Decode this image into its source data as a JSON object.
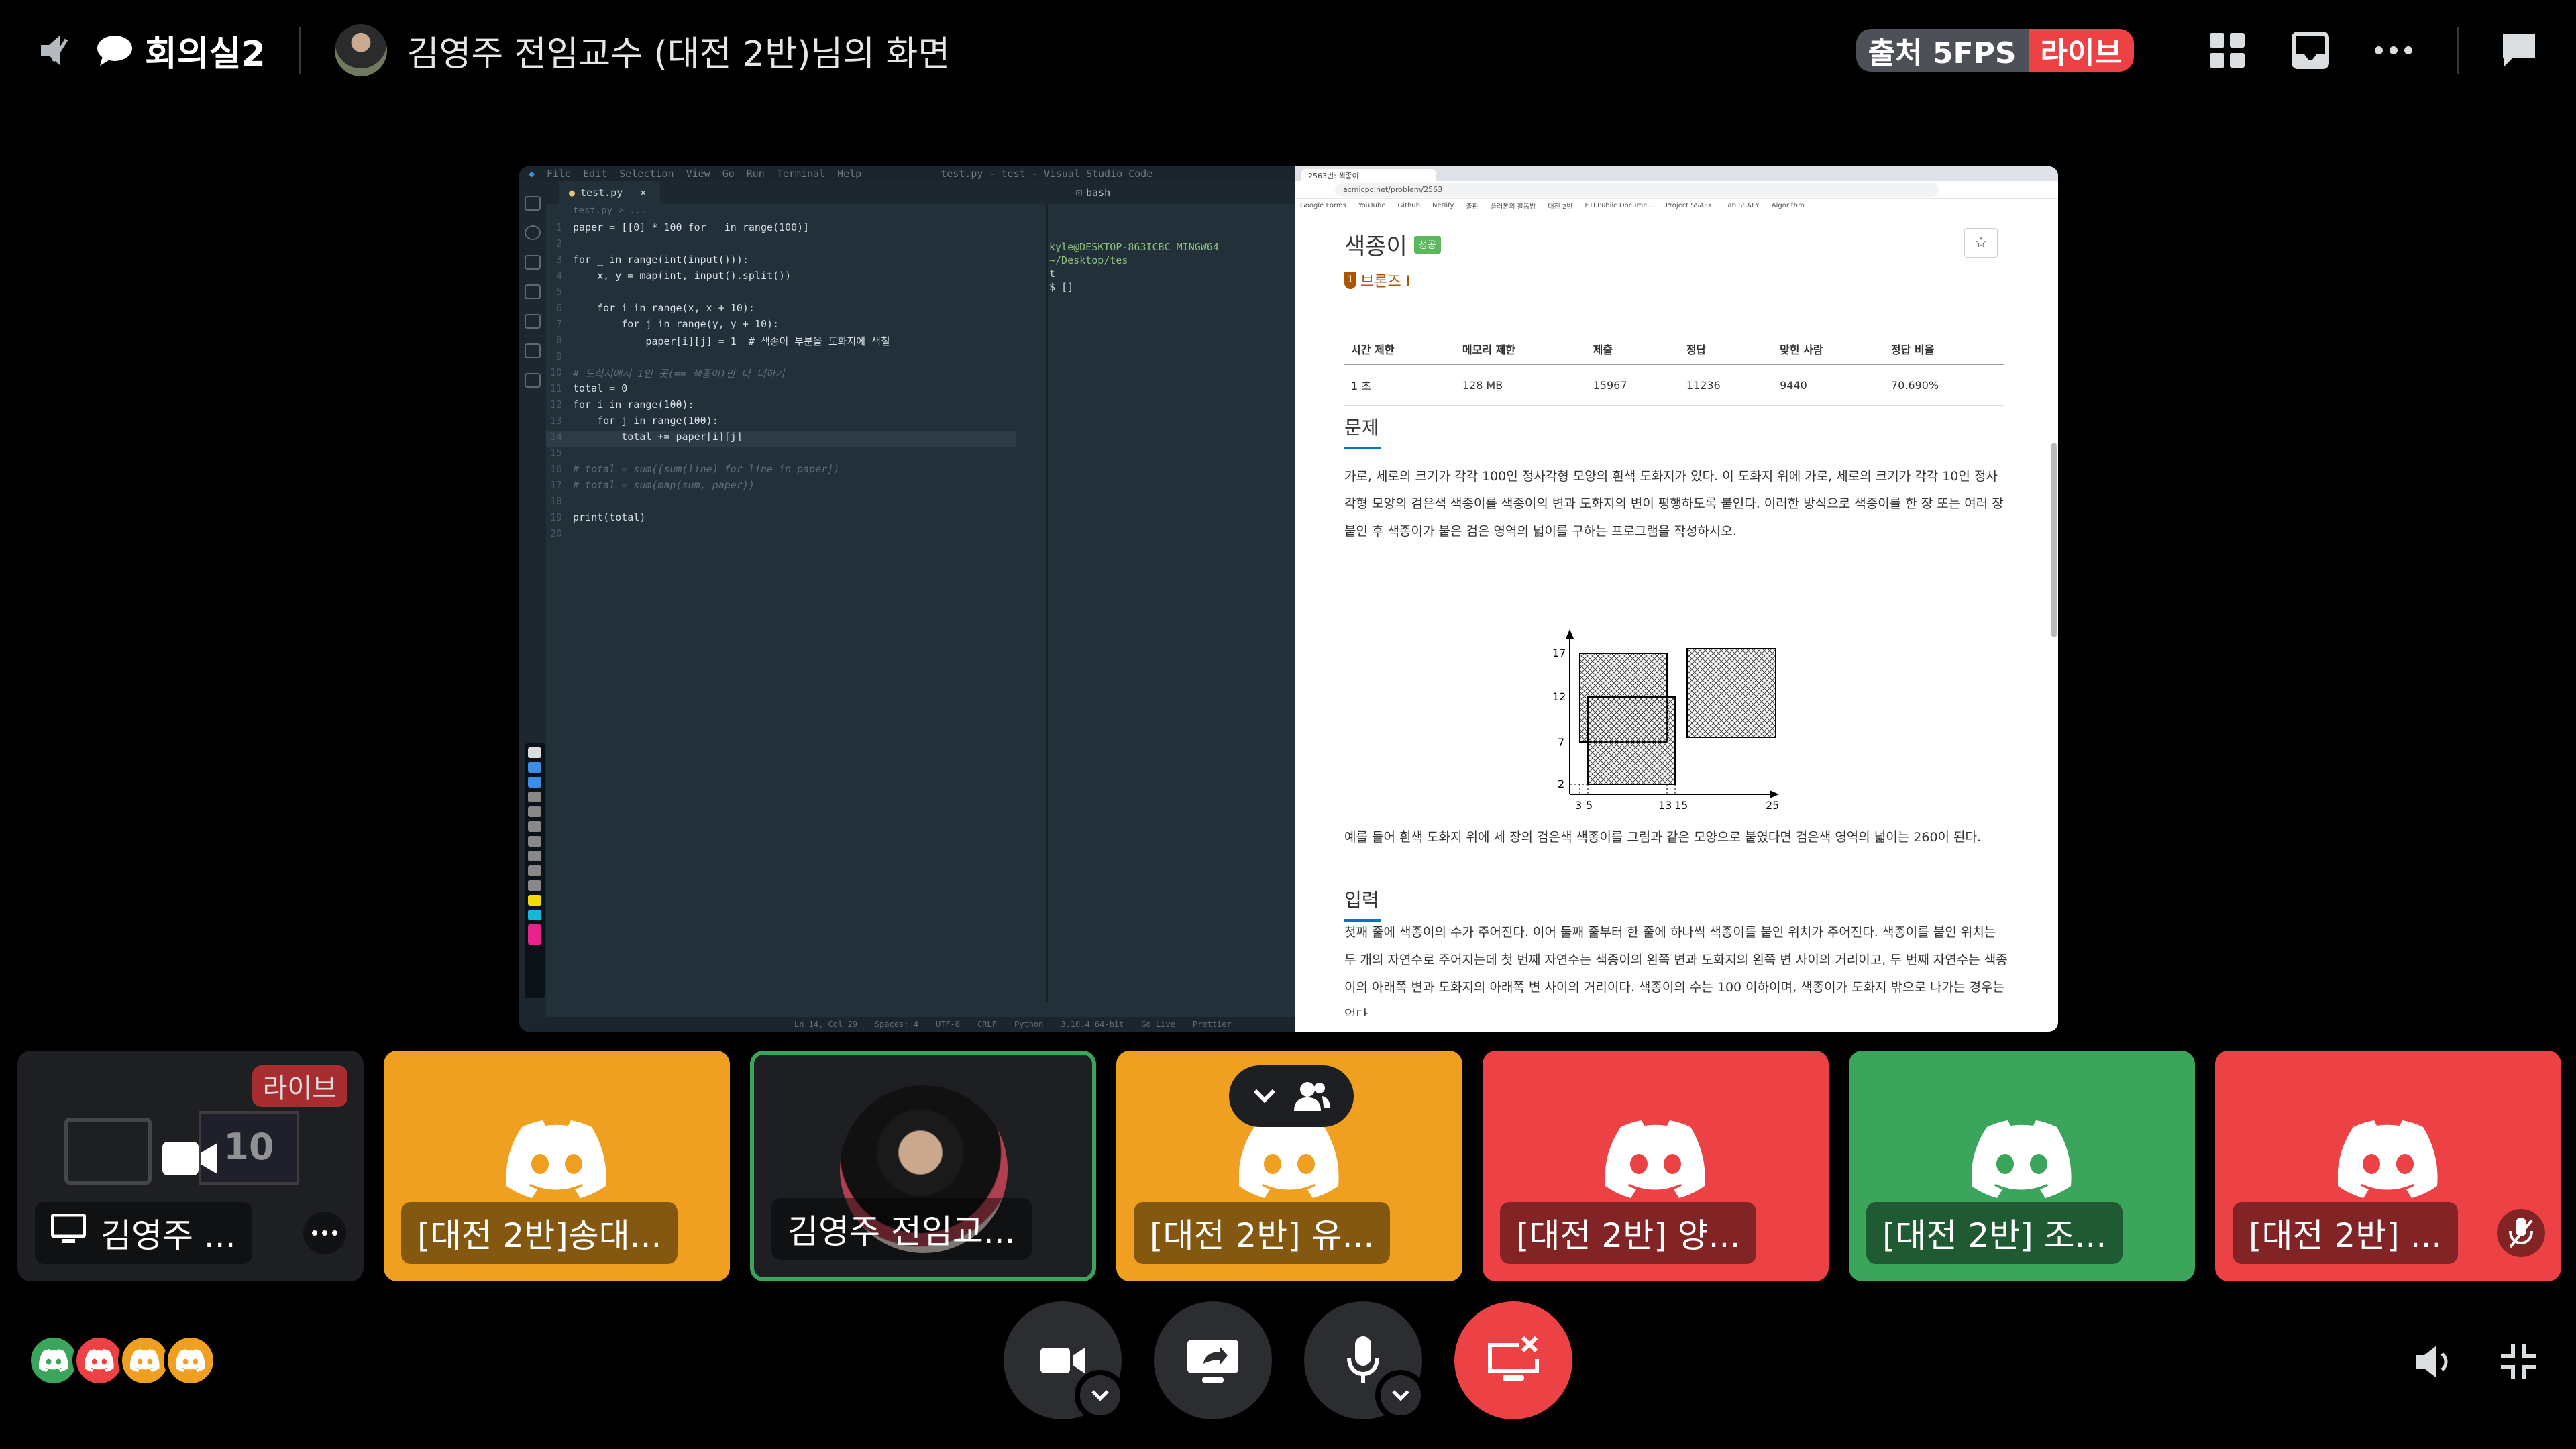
{
  "top_bar": {
    "room_name": "회의실2",
    "screen_title": "김영주 전임교수 (대전 2반)님의 화면",
    "fps_badge": "출처 5FPS",
    "live_badge": "라이브",
    "icons": [
      "speaker-muted-icon",
      "chat-bubble-icon",
      "grid-layout-icon",
      "popout-icon",
      "more-icon",
      "chat-icon"
    ]
  },
  "vscode": {
    "menu": [
      "File",
      "Edit",
      "Selection",
      "View",
      "Go",
      "Run",
      "Terminal",
      "Help"
    ],
    "window_title": "test.py - test - Visual Studio Code",
    "tab": "test.py",
    "breadcrumb": "test.py > ...",
    "terminal_tab": "bash",
    "code": [
      {
        "n": "1",
        "t": "paper = [[0] * 100 for _ in range(100)]"
      },
      {
        "n": "2",
        "t": ""
      },
      {
        "n": "3",
        "t": "for _ in range(int(input())):"
      },
      {
        "n": "4",
        "t": "    x, y = map(int, input().split())"
      },
      {
        "n": "5",
        "t": ""
      },
      {
        "n": "6",
        "t": "    for i in range(x, x + 10):"
      },
      {
        "n": "7",
        "t": "        for j in range(y, y + 10):"
      },
      {
        "n": "8",
        "t": "            paper[i][j] = 1  # 색종이 부분을 도화지에 색칠"
      },
      {
        "n": "9",
        "t": ""
      },
      {
        "n": "10",
        "t": "# 도화지에서 1인 곳(== 색종이)만 다 더하기"
      },
      {
        "n": "11",
        "t": "total = 0"
      },
      {
        "n": "12",
        "t": "for i in range(100):"
      },
      {
        "n": "13",
        "t": "    for j in range(100):"
      },
      {
        "n": "14",
        "t": "        total += paper[i][j]"
      },
      {
        "n": "15",
        "t": ""
      },
      {
        "n": "16",
        "t": "# total = sum([sum(line) for line in paper])"
      },
      {
        "n": "17",
        "t": "# total = sum(map(sum, paper))"
      },
      {
        "n": "18",
        "t": ""
      },
      {
        "n": "19",
        "t": "print(total)"
      },
      {
        "n": "20",
        "t": ""
      }
    ],
    "terminal_lines": [
      "kyle@DESKTOP-863ICBC MINGW64 ~/Desktop/tes",
      "t",
      "$ []"
    ],
    "status": [
      "Ln 14, Col 29",
      "Spaces: 4",
      "UTF-8",
      "CRLF",
      "Python",
      "3.10.4 64-bit",
      "Go Live",
      "Prettier"
    ]
  },
  "browser": {
    "tab_title": "2563번: 색종이",
    "url": "acmicpc.net/problem/2563",
    "bookmarks": [
      "Google Forms",
      "YouTube",
      "Github",
      "Netlify",
      "출판",
      "플러톤의 활동방",
      "대전 2반",
      "ETI Public Docume...",
      "Project SSAFY",
      "Lab SSAFY",
      "Algorithm"
    ],
    "problem_title": "색종이",
    "problem_badge": "성공",
    "tier": "브론즈 I",
    "star": "☆",
    "table_headers": [
      "시간 제한",
      "메모리 제한",
      "제출",
      "정답",
      "맞힌 사람",
      "정답 비율"
    ],
    "table_values": [
      "1 초",
      "128 MB",
      "15967",
      "11236",
      "9440",
      "70.690%"
    ],
    "section_problem": "문제",
    "problem_text": "가로, 세로의 크기가 각각 100인 정사각형 모양의 흰색 도화지가 있다. 이 도화지 위에 가로, 세로의 크기가 각각 10인 정사각형 모양의 검은색 색종이를 색종이의 변과 도화지의 변이 평행하도록 붙인다. 이러한 방식으로 색종이를 한 장 또는 여러 장 붙인 후 색종이가 붙은 검은 영역의 넓이를 구하는 프로그램을 작성하시오.",
    "figure_y_ticks": [
      "17",
      "12",
      "7",
      "2"
    ],
    "figure_x_ticks": [
      "3",
      "5",
      "13",
      "15",
      "25"
    ],
    "example_text": "예를 들어 흰색 도화지 위에 세 장의 검은색 색종이를 그림과 같은 모양으로 붙였다면 검은색 영역의 넓이는 260이 된다.",
    "section_input": "입력",
    "input_text": "첫째 줄에 색종이의 수가 주어진다. 이어 둘째 줄부터 한 줄에 하나씩 색종이를 붙인 위치가 주어진다. 색종이를 붙인 위치는 두 개의 자연수로 주어지는데 첫 번째 자연수는 색종이의 왼쪽 변과 도화지의 왼쪽 변 사이의 거리이고, 두 번째 자연수는 색종이의 아래쪽 변과 도화지의 아래쪽 변 사이의 거리이다. 색종이의 수는 100 이하이며, 색종이가 도화지 밖으로 나가는 경우는 없다"
  },
  "participants": [
    {
      "name": "김영주 ...",
      "color": "#1e1f22",
      "type": "stream",
      "live": "라이브",
      "stream_number": "10"
    },
    {
      "name": "[대전 2반]송대...",
      "color": "#f0a020",
      "type": "discord"
    },
    {
      "name": "김영주 전임교...",
      "color": "#1e1f22",
      "type": "camera"
    },
    {
      "name": "[대전 2반] 유...",
      "color": "#f0a020",
      "type": "discord"
    },
    {
      "name": "[대전 2반] 양...",
      "color": "#ed4245",
      "type": "discord"
    },
    {
      "name": "[대전 2반] 조...",
      "color": "#3ba55c",
      "type": "discord"
    },
    {
      "name": "[대전 2반] ...",
      "color": "#ed4245",
      "type": "discord"
    }
  ],
  "controls": [
    "camera-button",
    "screen-share-button",
    "microphone-button",
    "stop-stream-button"
  ],
  "colors": {
    "accent_red": "#ed4245",
    "accent_green": "#3ba55c",
    "accent_yellow": "#f0a020",
    "speaking_border": "#3ba55c"
  }
}
